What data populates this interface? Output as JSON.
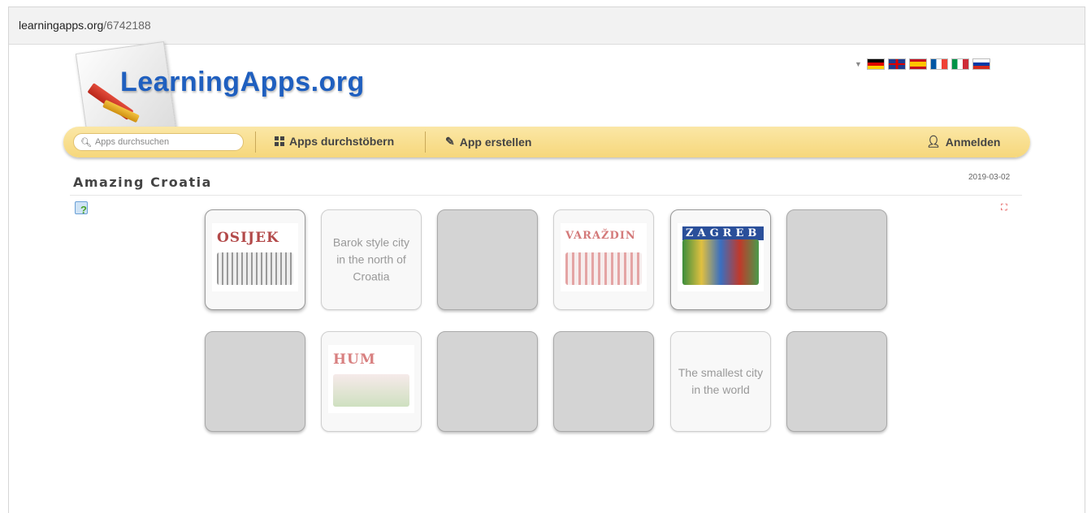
{
  "browser": {
    "url_host": "learningapps.org",
    "url_path": "/6742188"
  },
  "site": {
    "logo_text": "LearningApps.org"
  },
  "languages": [
    "de",
    "en",
    "es",
    "fr",
    "it",
    "ru"
  ],
  "nav": {
    "search_placeholder": "Apps durchsuchen",
    "browse_label": "Apps durchstöbern",
    "create_label": "App erstellen",
    "login_label": "Anmelden"
  },
  "app": {
    "title": "Amazing Croatia",
    "date": "2019-03-02"
  },
  "cards": {
    "row1": [
      {
        "state": "image",
        "caption": "OSIJEK",
        "caption_color": "#b34a4a",
        "sketch": "bridge-and-cathedral"
      },
      {
        "state": "text",
        "text": "Barok style city in the north of Croatia"
      },
      {
        "state": "hidden"
      },
      {
        "state": "image",
        "caption": "VARAŽDIN",
        "caption_color": "#d47a7a",
        "sketch": "castle-town"
      },
      {
        "state": "image",
        "caption": "ZAGREB",
        "caption_color": "#1f4e9a",
        "sketch": "colorful-city"
      },
      {
        "state": "hidden"
      }
    ],
    "row2": [
      {
        "state": "hidden"
      },
      {
        "state": "image",
        "caption": "HUM",
        "caption_color": "#d88080",
        "sketch": "hill-town"
      },
      {
        "state": "hidden"
      },
      {
        "state": "hidden"
      },
      {
        "state": "text",
        "text": "The smallest city in the world"
      },
      {
        "state": "hidden"
      }
    ]
  },
  "colors": {
    "navbar": "#f6d77b",
    "logo_blue": "#1f5fbf",
    "card_hidden": "#d4d4d4"
  }
}
